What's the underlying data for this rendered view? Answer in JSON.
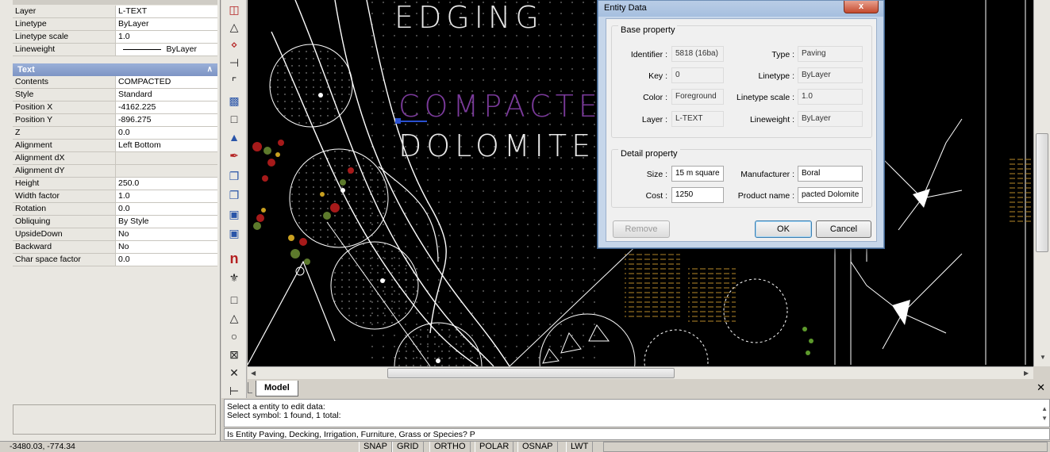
{
  "properties": {
    "rows_top": [
      {
        "key": "Layer",
        "value": "L-TEXT"
      },
      {
        "key": "Linetype",
        "value": "ByLayer"
      },
      {
        "key": "Linetype scale",
        "value": "1.0"
      },
      {
        "key": "Lineweight",
        "value": "ByLayer"
      }
    ],
    "group_title": "Text",
    "rows_text": [
      {
        "key": "Contents",
        "value": "COMPACTED"
      },
      {
        "key": "Style",
        "value": "Standard"
      },
      {
        "key": "Position X",
        "value": "-4162.225"
      },
      {
        "key": "Position Y",
        "value": "-896.275"
      },
      {
        "key": "Z",
        "value": "0.0"
      },
      {
        "key": "Alignment",
        "value": "Left Bottom"
      },
      {
        "key": "Alignment dX",
        "value": ""
      },
      {
        "key": "Alignment dY",
        "value": ""
      },
      {
        "key": "Height",
        "value": "250.0"
      },
      {
        "key": "Width factor",
        "value": "1.0"
      },
      {
        "key": "Rotation",
        "value": "0.0"
      },
      {
        "key": "Obliquing",
        "value": "By Style"
      },
      {
        "key": "UpsideDown",
        "value": "No"
      },
      {
        "key": "Backward",
        "value": "No"
      },
      {
        "key": "Char space factor",
        "value": "0.0"
      }
    ]
  },
  "canvas": {
    "labels": {
      "edging": "EDGING",
      "compacted": "COMPACTE",
      "dolomite": "DOLOMITE"
    },
    "colors": {
      "background": "#000000",
      "lines": "#ffffff",
      "compacted_text": "#7a3a9a",
      "grip": "#2a50d0"
    }
  },
  "tabs": {
    "model": "Model"
  },
  "command": {
    "lines": [
      "Select a entity to edit data:",
      "Select symbol: 1 found, 1 total:"
    ],
    "prompt": "Is Entity Paving, Decking, Irrigation, Furniture, Grass or Species? P"
  },
  "status": {
    "coords": "-3480.03,  -774.34",
    "buttons": [
      "SNAP",
      "GRID",
      "ORTHO",
      "POLAR",
      "OSNAP",
      "LWT"
    ]
  },
  "dialog": {
    "title": "Entity Data",
    "close_label": "x",
    "base_legend": "Base property",
    "detail_legend": "Detail property",
    "base": {
      "identifier_label": "Identifier :",
      "identifier": "5818 (16ba)",
      "type_label": "Type :",
      "type": "Paving",
      "key_label": "Key :",
      "key": "0",
      "linetype_label": "Linetype :",
      "linetype": "ByLayer",
      "color_label": "Color :",
      "color": "Foreground",
      "ltscale_label": "Linetype scale :",
      "ltscale": "1.0",
      "layer_label": "Layer :",
      "layer": "L-TEXT",
      "lineweight_label": "Lineweight :",
      "lineweight": "ByLayer"
    },
    "detail": {
      "size_label": "Size :",
      "size": "15 m square",
      "manufacturer_label": "Manufacturer :",
      "manufacturer": "Boral",
      "cost_label": "Cost :",
      "cost": "1250",
      "product_label": "Product name :",
      "product": "pacted Dolomite"
    },
    "buttons": {
      "remove": "Remove",
      "ok": "OK",
      "cancel": "Cancel"
    }
  }
}
